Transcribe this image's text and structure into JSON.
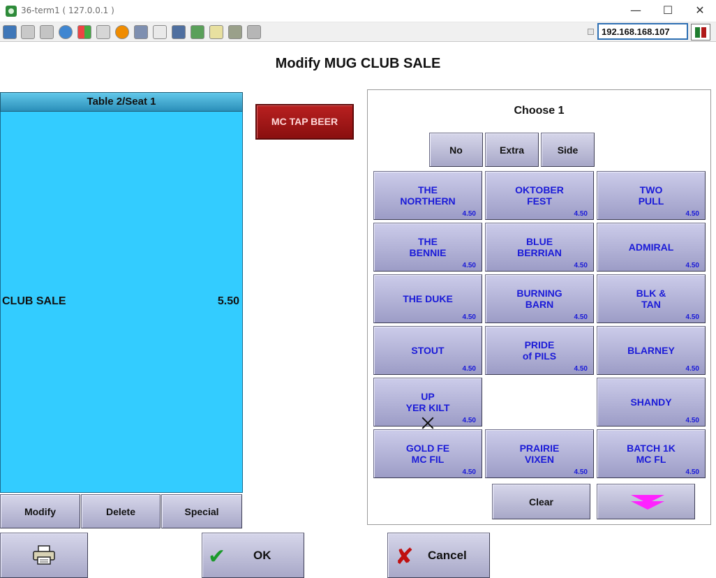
{
  "window": {
    "title": "36-term1 ( 127.0.0.1 )",
    "minimize": "—",
    "maximize": "☐",
    "close": "✕"
  },
  "toolbar": {
    "ip_address": "192.168.168.107"
  },
  "page": {
    "title": "Modify MUG CLUB SALE"
  },
  "check": {
    "header": "Table 2/Seat 1",
    "lines": [
      {
        "name": "CLUB SALE",
        "price": "5.50"
      }
    ],
    "buttons": {
      "modify": "Modify",
      "delete": "Delete",
      "special": "Special"
    }
  },
  "category": {
    "label": "MC TAP BEER"
  },
  "choose": {
    "title": "Choose 1",
    "qualifiers": {
      "no": "No",
      "extra": "Extra",
      "side": "Side"
    },
    "items": [
      {
        "label": "THE\nNORTHERN",
        "price": "4.50"
      },
      {
        "label": "OKTOBER\nFEST",
        "price": "4.50"
      },
      {
        "label": "TWO\nPULL",
        "price": "4.50"
      },
      {
        "label": "THE\nBENNIE",
        "price": "4.50"
      },
      {
        "label": "BLUE\nBERRIAN",
        "price": "4.50"
      },
      {
        "label": "ADMIRAL",
        "price": "4.50"
      },
      {
        "label": "THE DUKE",
        "price": "4.50"
      },
      {
        "label": "BURNING\nBARN",
        "price": "4.50"
      },
      {
        "label": "BLK &\nTAN",
        "price": "4.50"
      },
      {
        "label": "STOUT",
        "price": "4.50"
      },
      {
        "label": "PRIDE\nof PILS",
        "price": "4.50"
      },
      {
        "label": "BLARNEY",
        "price": "4.50"
      },
      {
        "label": "UP\nYER KILT",
        "price": "4.50"
      },
      {
        "label": "SHANDY",
        "price": "4.50"
      },
      {
        "label": "GOLD FE\nMC FIL",
        "price": "4.50"
      },
      {
        "label": "PRAIRIE\nVIXEN",
        "price": "4.50"
      },
      {
        "label": "BATCH 1K\nMC FL",
        "price": "4.50"
      }
    ],
    "clear": "Clear"
  },
  "footer": {
    "ok": "OK",
    "cancel": "Cancel"
  },
  "icons": {
    "printer": "printer-icon",
    "ok": "checkmark-icon",
    "cancel": "x-icon",
    "page_down": "double-chevron-down-icon"
  },
  "colors": {
    "check_background": "#33ccff",
    "category_button": "#a01818",
    "item_text": "#1a1ad8",
    "page_down_arrow": "#ff22ff"
  }
}
